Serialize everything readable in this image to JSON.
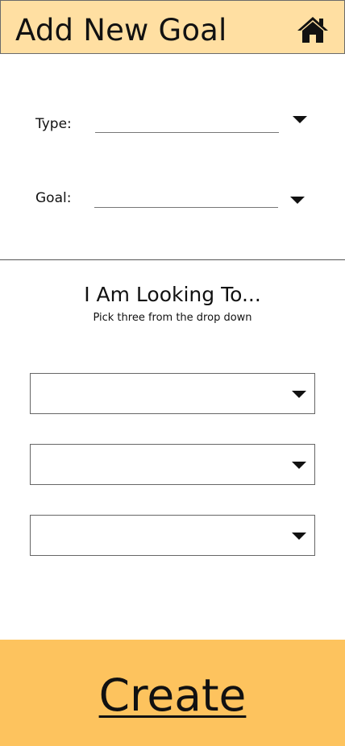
{
  "header": {
    "title": "Add New Goal",
    "home_icon": "home-icon",
    "background": "#ffdfa2"
  },
  "form": {
    "type_label": "Type:",
    "type_value": "",
    "goal_label": "Goal:",
    "goal_value": ""
  },
  "looking": {
    "title": "I Am Looking To...",
    "subtitle": "Pick three from the drop down",
    "selects": [
      {
        "value": ""
      },
      {
        "value": ""
      },
      {
        "value": ""
      }
    ]
  },
  "footer": {
    "create_label": "Create",
    "background": "#fdc35e"
  }
}
